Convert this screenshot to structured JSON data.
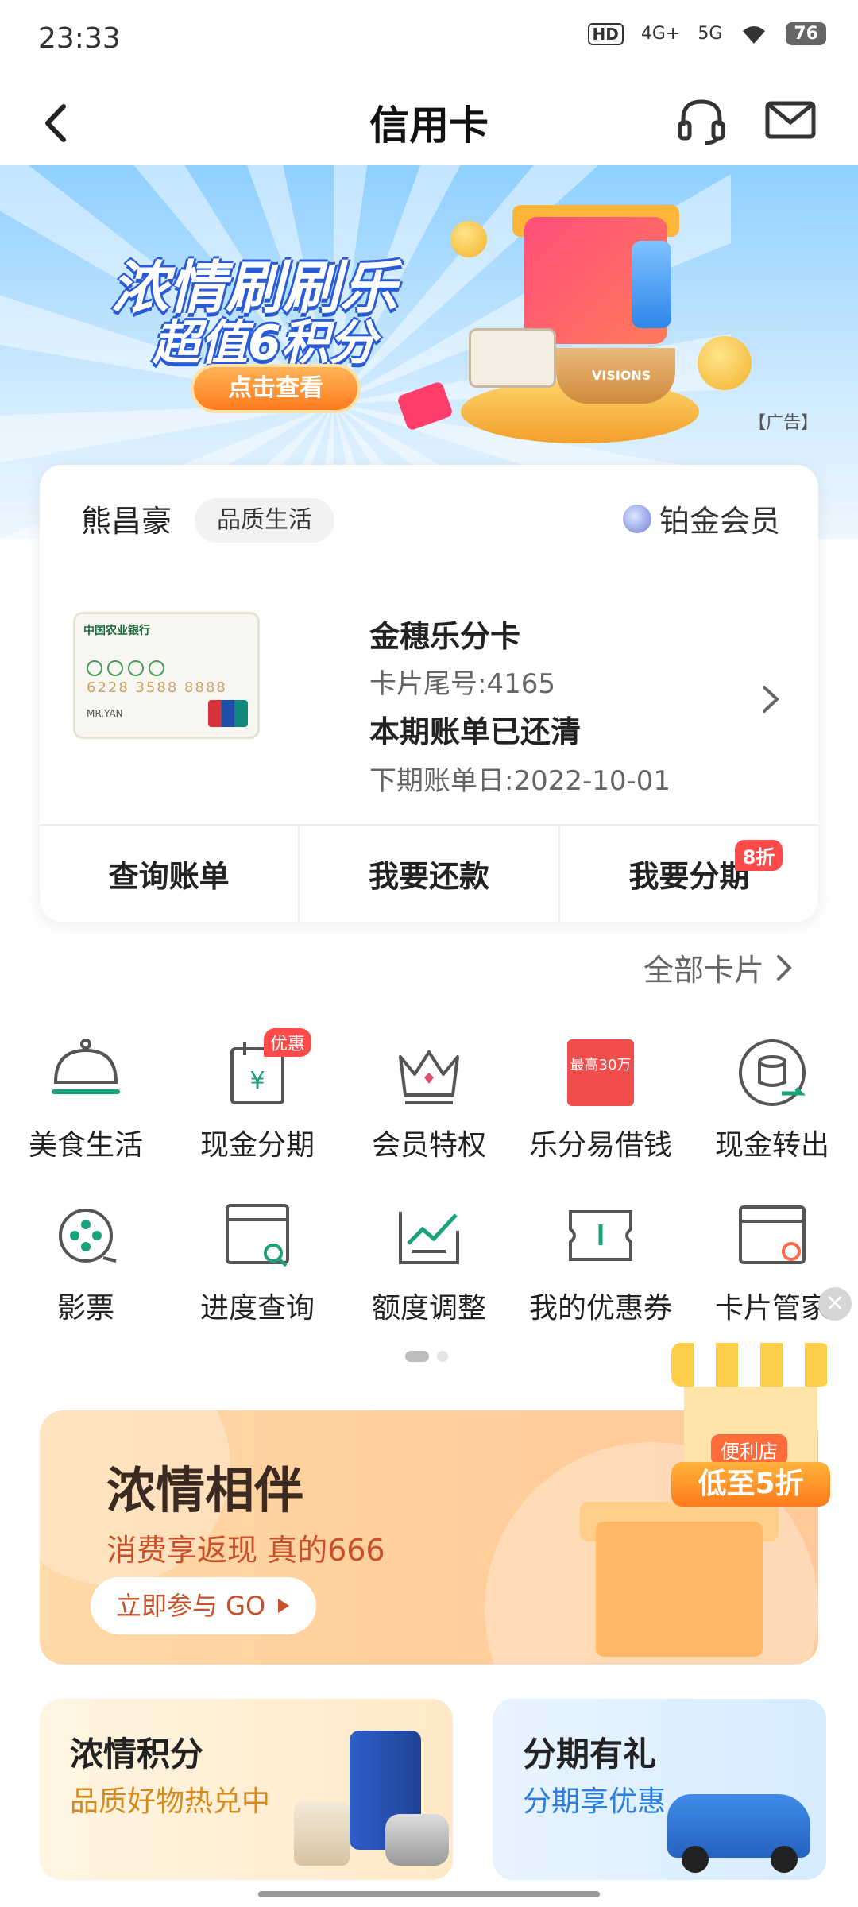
{
  "status": {
    "time": "23:33",
    "hd": "HD",
    "signal1": "4G+",
    "signal2": "5G",
    "battery": "76"
  },
  "nav": {
    "title": "信用卡",
    "icons": [
      "back-icon",
      "headset-icon",
      "mail-icon"
    ]
  },
  "banner": {
    "line1": "浓情刷刷乐",
    "line2": "超值6积分",
    "button": "点击查看",
    "ad": "【广告】",
    "pot_brand": "VISIONS"
  },
  "card_panel": {
    "owner": "熊昌豪",
    "tag": "品质生活",
    "member_level": "铂金会员",
    "card_image": {
      "bank": "中国农业银行",
      "number": "6228 3588 8888",
      "name": "MR.YAN"
    },
    "card_name": "金穗乐分卡",
    "card_tail": "卡片尾号:4165",
    "bill_status": "本期账单已还清",
    "next_bill": "下期账单日:2022-10-01",
    "actions": [
      {
        "label": "查询账单"
      },
      {
        "label": "我要还款"
      },
      {
        "label": "我要分期",
        "badge": "8折"
      }
    ]
  },
  "all_cards": "全部卡片",
  "grid": {
    "row1": [
      {
        "label": "美食生活",
        "icon": "food-cloche-icon"
      },
      {
        "label": "现金分期",
        "icon": "cash-installment-icon",
        "badge": "优惠"
      },
      {
        "label": "会员特权",
        "icon": "crown-icon"
      },
      {
        "label": "乐分易借钱",
        "icon": "loan-icon",
        "icon_text": "最高30万"
      },
      {
        "label": "现金转出",
        "icon": "cash-transfer-icon"
      }
    ],
    "row2": [
      {
        "label": "影票",
        "icon": "film-reel-icon"
      },
      {
        "label": "进度查询",
        "icon": "progress-search-icon"
      },
      {
        "label": "额度调整",
        "icon": "limit-chart-icon"
      },
      {
        "label": "我的优惠券",
        "icon": "coupon-icon"
      },
      {
        "label": "卡片管家",
        "icon": "card-settings-icon"
      }
    ]
  },
  "floating_shop": {
    "name": "便利店",
    "sale": "低至5折"
  },
  "promo": {
    "title": "浓情相伴",
    "subtitle": "消费享返现 真的666",
    "button": "立即参与 GO"
  },
  "bottom_cards": [
    {
      "title": "浓情积分",
      "subtitle": "品质好物热兑中"
    },
    {
      "title": "分期有礼",
      "subtitle": "分期享优惠"
    }
  ],
  "colors": {
    "accent_green": "#1aa37a",
    "red_badge": "#ff4a4a",
    "orange": "#ff7a1c"
  }
}
